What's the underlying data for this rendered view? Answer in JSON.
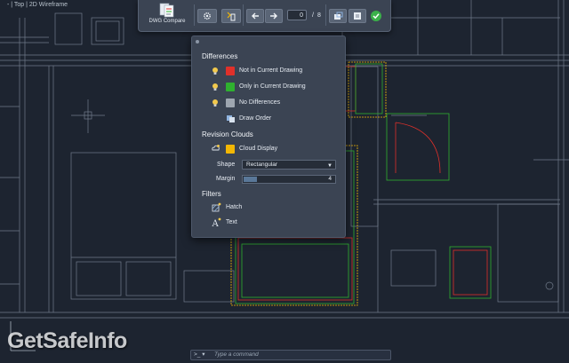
{
  "viewport": {
    "label": "- | Top | 2D Wireframe"
  },
  "toolbar": {
    "app_label": "DWG Compare",
    "icons": [
      "settings-icon",
      "toggle-compare-icon",
      "arrow-left-icon",
      "arrow-right-icon",
      "copy-to-current-icon",
      "export-snapshot-icon",
      "checkmark-icon"
    ],
    "current_index": "0",
    "separator": "/",
    "total": "8"
  },
  "panel": {
    "differences": {
      "title": "Differences",
      "items": [
        {
          "label": "Not in Current Drawing",
          "color": "#e0302a",
          "icon": "lightbulb-icon"
        },
        {
          "label": "Only in Current Drawing",
          "color": "#2fb12f",
          "icon": "lightbulb-icon"
        },
        {
          "label": "No Differences",
          "color": "#9ea6b0",
          "icon": "lightbulb-icon"
        }
      ],
      "draw_order_label": "Draw Order"
    },
    "revision_clouds": {
      "title": "Revision Clouds",
      "cloud_display_label": "Cloud Display",
      "cloud_color": "#f2b705",
      "shape_label": "Shape",
      "shape_value": "Rectangular",
      "margin_label": "Margin",
      "margin_value": "4",
      "margin_fraction": 0.14
    },
    "filters": {
      "title": "Filters",
      "hatch_label": "Hatch",
      "text_label": "Text"
    }
  },
  "command_line": {
    "prompt": ">_ ▾",
    "placeholder": "Type a command"
  },
  "watermark": {
    "text": "GetSafeInfo"
  },
  "colors": {
    "background": "#1d2430",
    "drawing_lines": "#8d98a8",
    "not_in_current": "#e0302a",
    "only_in_current": "#2fb12f"
  }
}
